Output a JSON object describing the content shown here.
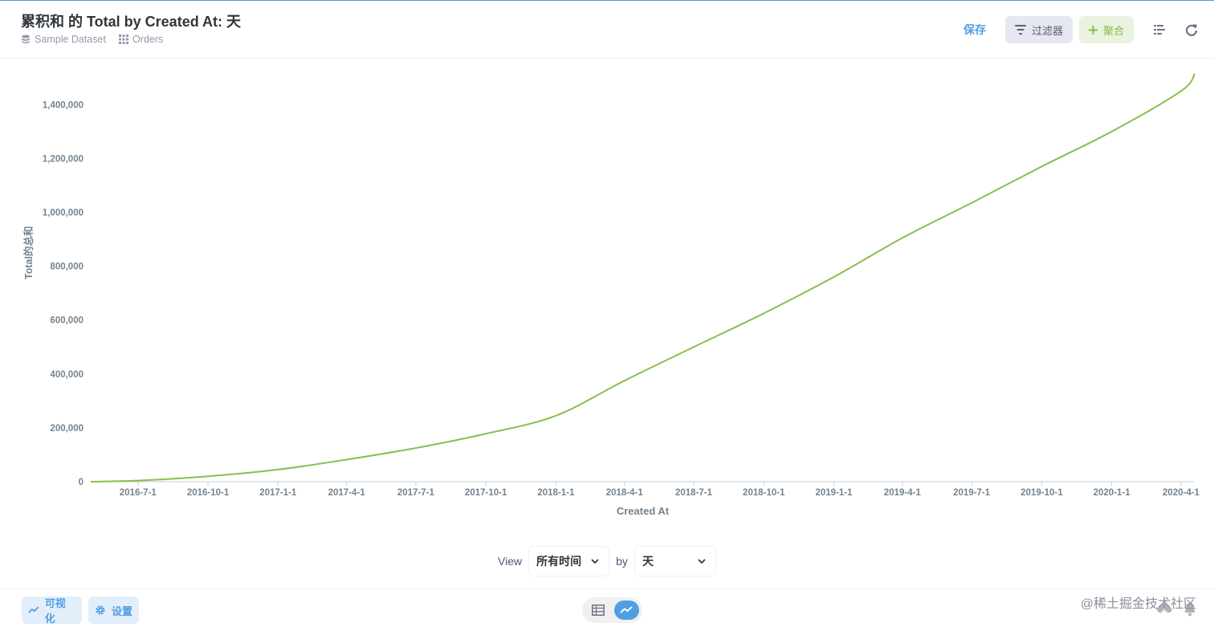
{
  "header": {
    "title": "累积和 的 Total by Created At: 天",
    "breadcrumbs": [
      {
        "label": "Sample Dataset",
        "icon": "database-icon"
      },
      {
        "label": "Orders",
        "icon": "table-grid-icon"
      }
    ],
    "save_label": "保存",
    "filter_label": "过滤器",
    "summarize_label": "聚合"
  },
  "chart_data": {
    "type": "line",
    "xlabel": "Created At",
    "ylabel": "Total的总和",
    "x_ticks": [
      "2016-7-1",
      "2016-10-1",
      "2017-1-1",
      "2017-4-1",
      "2017-7-1",
      "2017-10-1",
      "2018-1-1",
      "2018-4-1",
      "2018-7-1",
      "2018-10-1",
      "2019-1-1",
      "2019-4-1",
      "2019-7-1",
      "2019-10-1",
      "2020-1-1",
      "2020-4-1"
    ],
    "y_ticks": [
      "0",
      "200,000",
      "400,000",
      "600,000",
      "800,000",
      "1,000,000",
      "1,200,000",
      "1,400,000"
    ],
    "ylim": [
      0,
      1520000
    ],
    "x_range": [
      "2016-4-30",
      "2020-4-19"
    ],
    "color": "#88bf4d",
    "series": [
      {
        "x": [
          "2016-4-30",
          "2016-7-1",
          "2016-10-1",
          "2017-1-1",
          "2017-4-1",
          "2017-7-1",
          "2017-10-1",
          "2018-1-1",
          "2018-4-1",
          "2018-7-1",
          "2018-10-1",
          "2019-1-1",
          "2019-4-1",
          "2019-7-1",
          "2019-10-1",
          "2020-1-1",
          "2020-4-1",
          "2020-4-19"
        ],
        "values": [
          0,
          4000,
          20000,
          45000,
          82000,
          125000,
          178000,
          245000,
          375000,
          500000,
          625000,
          760000,
          905000,
          1035000,
          1170000,
          1300000,
          1450000,
          1515000
        ]
      }
    ]
  },
  "view_controls": {
    "view_label": "View",
    "time_range": "所有时间",
    "by_label": "by",
    "unit": "天"
  },
  "footer": {
    "visualization_label": "可视化",
    "settings_label": "设置",
    "watermark": "@稀土掘金技术社区"
  }
}
